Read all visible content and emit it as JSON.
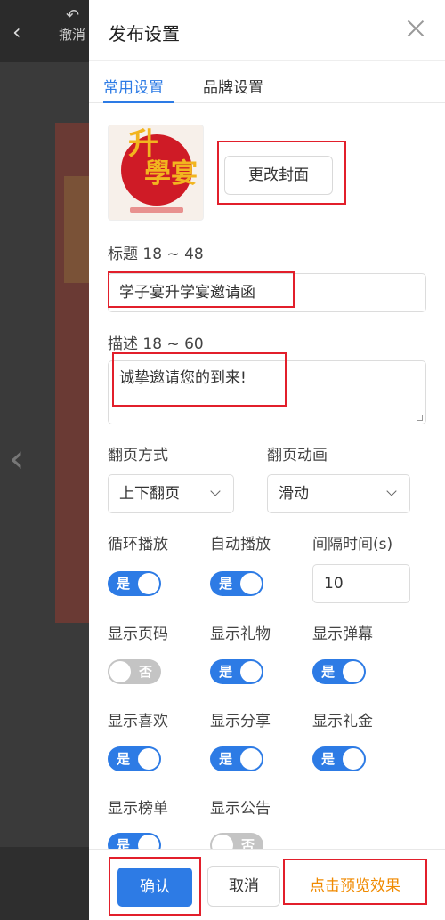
{
  "background": {
    "undo_label": "撤消"
  },
  "panel": {
    "title": "发布设置",
    "tabs": [
      "常用设置",
      "品牌设置"
    ],
    "cover": {
      "text_top": "升",
      "text_mid": "學宴",
      "change_button": "更改封面"
    },
    "title_field": {
      "label": "标题 18 ~ 48",
      "value": "学子宴升学宴邀请函"
    },
    "desc_field": {
      "label": "描述 18 ~ 60",
      "value": "诚挚邀请您的到来!"
    },
    "page_turn": {
      "label": "翻页方式",
      "value": "上下翻页"
    },
    "page_anim": {
      "label": "翻页动画",
      "value": "滑动"
    },
    "loop": {
      "label": "循环播放",
      "state": "是",
      "on": true
    },
    "autoplay": {
      "label": "自动播放",
      "state": "是",
      "on": true
    },
    "interval": {
      "label": "间隔时间(s)",
      "value": "10"
    },
    "show_page_num": {
      "label": "显示页码",
      "state": "否",
      "on": false
    },
    "show_gift": {
      "label": "显示礼物",
      "state": "是",
      "on": true
    },
    "show_barrage": {
      "label": "显示弹幕",
      "state": "是",
      "on": true
    },
    "show_like": {
      "label": "显示喜欢",
      "state": "是",
      "on": true
    },
    "show_share": {
      "label": "显示分享",
      "state": "是",
      "on": true
    },
    "show_money": {
      "label": "显示礼金",
      "state": "是",
      "on": true
    },
    "show_rank": {
      "label": "显示榜单",
      "state": "是",
      "on": true
    },
    "show_notice": {
      "label": "显示公告",
      "state": "否",
      "on": false
    },
    "footer": {
      "confirm": "确认",
      "cancel": "取消",
      "preview": "点击预览效果"
    }
  },
  "colors": {
    "accent": "#2d7be5",
    "highlight_box": "#e21f2b",
    "preview_text": "#f08a00"
  }
}
